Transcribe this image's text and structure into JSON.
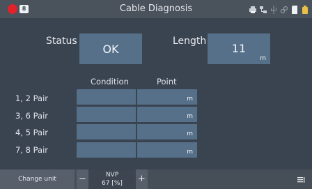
{
  "window": {
    "title": "Cable Diagnosis",
    "badge": "8",
    "status_icons": [
      "printer-icon",
      "network-icon",
      "usb-icon",
      "link-icon",
      "sd-card-icon",
      "battery-icon"
    ]
  },
  "status": {
    "label": "Status",
    "value": "OK"
  },
  "length": {
    "label": "Length",
    "value": "11",
    "unit": "m"
  },
  "table": {
    "headers": {
      "condition": "Condition",
      "point": "Point"
    },
    "rows": [
      {
        "label": "1, 2 Pair",
        "condition": "",
        "point": "",
        "unit": "m"
      },
      {
        "label": "3, 6 Pair",
        "condition": "",
        "point": "",
        "unit": "m"
      },
      {
        "label": "4, 5 Pair",
        "condition": "",
        "point": "",
        "unit": "m"
      },
      {
        "label": "7, 8 Pair",
        "condition": "",
        "point": "",
        "unit": "m"
      }
    ]
  },
  "bottom": {
    "change_unit": "Change unit",
    "minus": "−",
    "nvp_label": "NVP",
    "nvp_value": "67 [%]",
    "plus": "+"
  },
  "colors": {
    "background": "#3a4350",
    "field": "#56708a",
    "close": "#e0232b"
  }
}
